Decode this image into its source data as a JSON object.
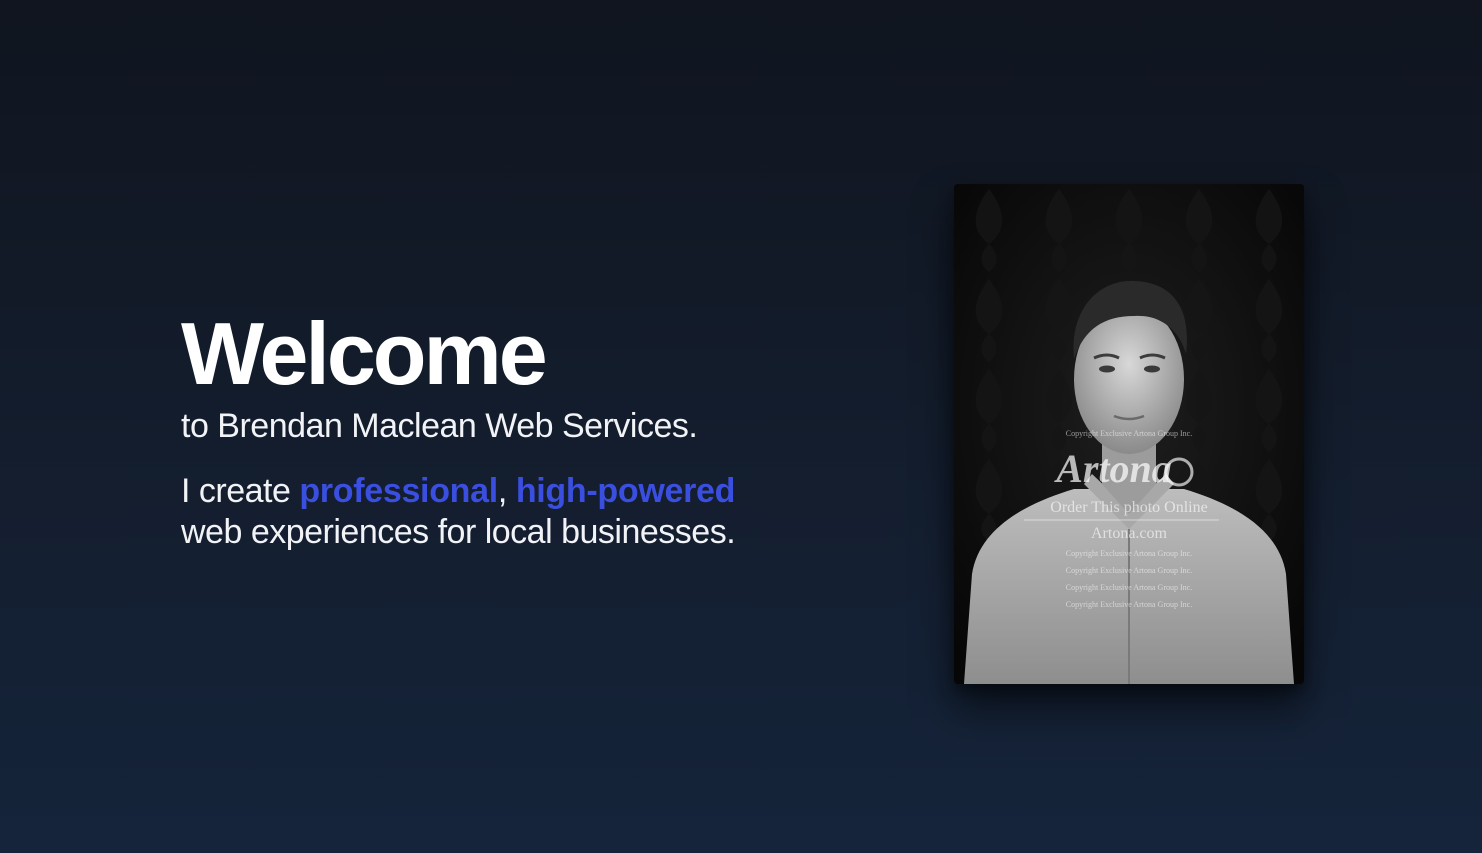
{
  "hero": {
    "title": "Welcome",
    "subtitle": "to Brendan Maclean Web Services.",
    "pitch_prefix": "I create ",
    "highlight_1": "professional",
    "separator": ", ",
    "highlight_2": "high-powered",
    "pitch_suffix": "web experiences for local businesses."
  },
  "portrait": {
    "watermark_brand": "Artona",
    "watermark_copyright_line": "Copyright Exclusive Artona Group Inc.",
    "watermark_order": "Order This photo Online",
    "watermark_site": "Artona.com"
  },
  "colors": {
    "accent": "#3a4ee0",
    "background_top": "#10151f",
    "background_bottom": "#15243b"
  }
}
